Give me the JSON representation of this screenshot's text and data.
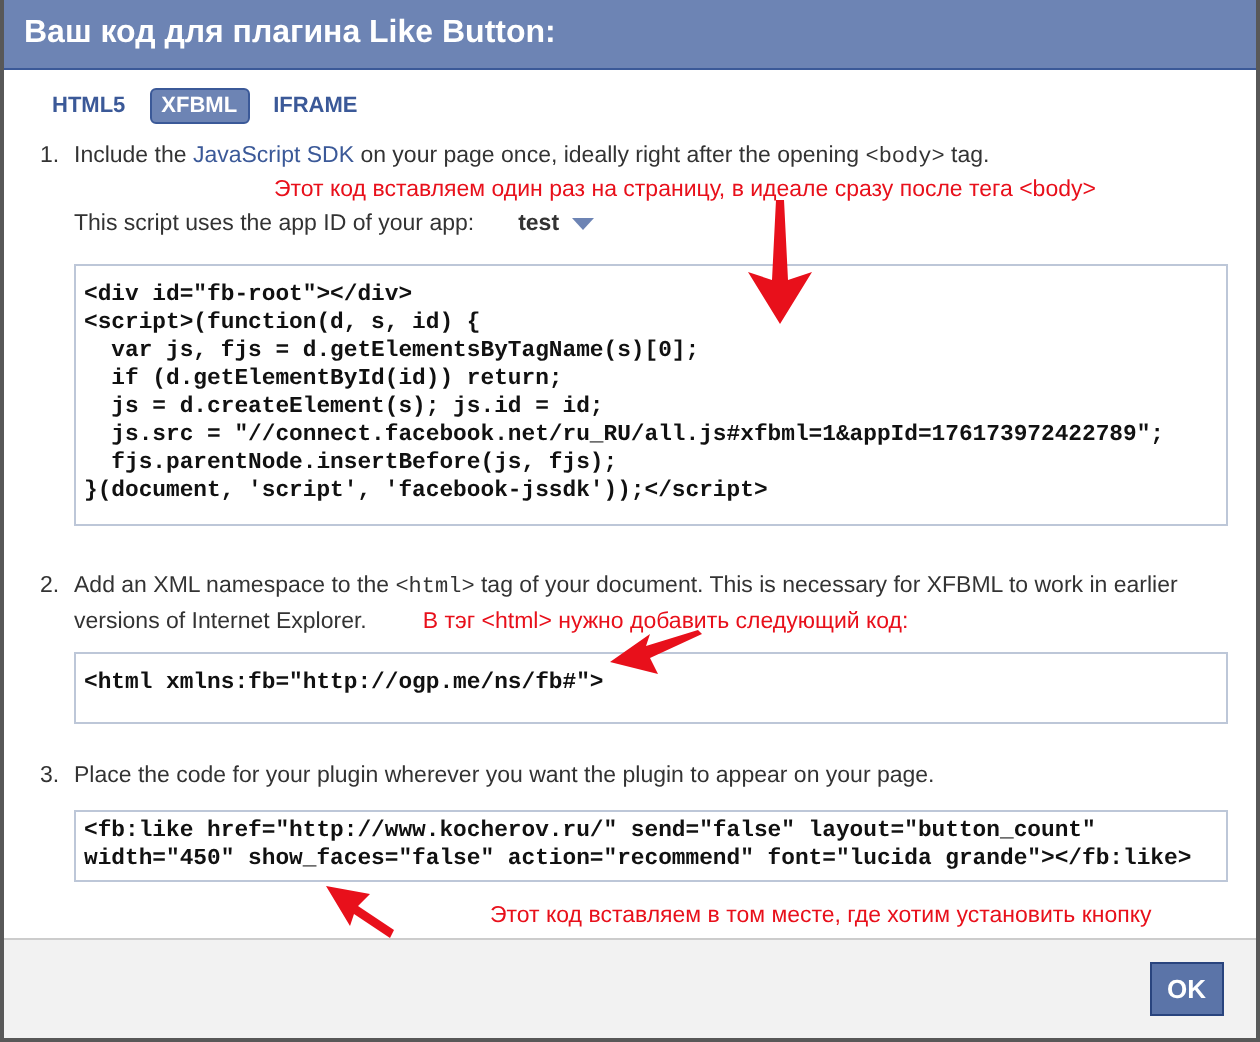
{
  "dialog": {
    "title": "Ваш код для плагина Like Button:"
  },
  "tabs": [
    {
      "label": "HTML5",
      "selected": false
    },
    {
      "label": "XFBML",
      "selected": true
    },
    {
      "label": "IFRAME",
      "selected": false
    }
  ],
  "steps": [
    {
      "number": "1.",
      "parts": [
        {
          "kind": "text",
          "text": "Include the "
        },
        {
          "kind": "link",
          "text": "JavaScript SDK"
        },
        {
          "kind": "text",
          "text": " on your page once, ideally right after the opening "
        },
        {
          "kind": "code",
          "text": "<body>"
        },
        {
          "kind": "text",
          "text": " tag."
        }
      ],
      "note": "Этот код вставляем один раз на страницу, в идеале сразу после тега <body>",
      "app_id": {
        "label": "This script uses the app ID of your app:",
        "value": "test"
      },
      "code": "<div id=\"fb-root\"></div>\n<script>(function(d, s, id) {\n  var js, fjs = d.getElementsByTagName(s)[0];\n  if (d.getElementById(id)) return;\n  js = d.createElement(s); js.id = id;\n  js.src = \"//connect.facebook.net/ru_RU/all.js#xfbml=1&appId=176173972422789\";\n  fjs.parentNode.insertBefore(js, fjs);\n}(document, 'script', 'facebook-jssdk'));</script>"
    },
    {
      "number": "2.",
      "parts": [
        {
          "kind": "text",
          "text": "Add an XML namespace to the "
        },
        {
          "kind": "code",
          "text": "<html>"
        },
        {
          "kind": "text",
          "text": " tag of your document. This is necessary for XFBML to work in earlier versions of Internet Explorer."
        }
      ],
      "note": "В тэг <html> нужно добавить следующий код:",
      "code": "<html xmlns:fb=\"http://ogp.me/ns/fb#\">"
    },
    {
      "number": "3.",
      "parts": [
        {
          "kind": "text",
          "text": "Place the code for your plugin wherever you want the plugin to appear on your page."
        }
      ],
      "code": "<fb:like href=\"http://www.kocherov.ru/\" send=\"false\" layout=\"button_count\" width=\"450\" show_faces=\"false\" action=\"recommend\" font=\"lucida grande\"></fb:like>",
      "note": "Этот код вставляем в том месте, где хотим установить кнопку"
    }
  ],
  "buttons": [
    "OK"
  ]
}
